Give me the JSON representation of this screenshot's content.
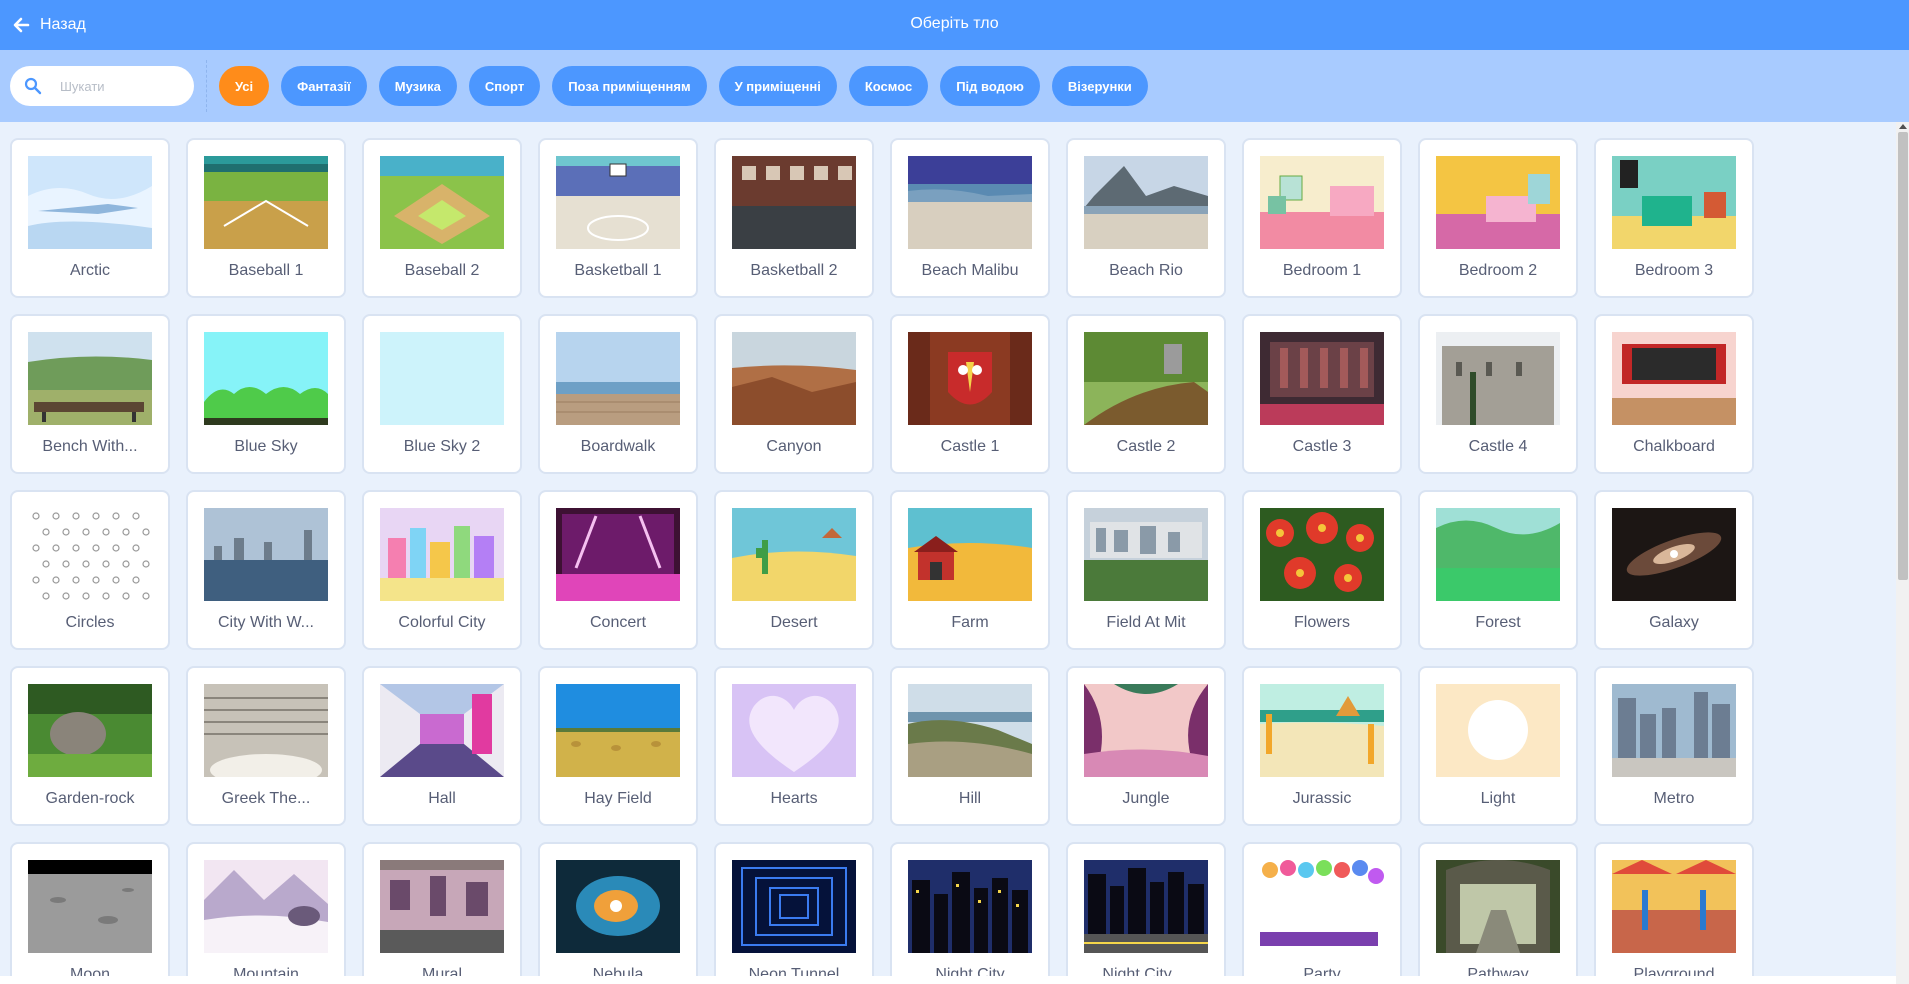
{
  "header": {
    "back_label": "Назад",
    "title": "Оберіть тло"
  },
  "search": {
    "placeholder": "Шукати",
    "value": ""
  },
  "tags": [
    {
      "label": "Усі",
      "active": true
    },
    {
      "label": "Фантазії",
      "active": false
    },
    {
      "label": "Музика",
      "active": false
    },
    {
      "label": "Спорт",
      "active": false
    },
    {
      "label": "Поза приміщенням",
      "active": false
    },
    {
      "label": "У приміщенні",
      "active": false
    },
    {
      "label": "Космос",
      "active": false
    },
    {
      "label": "Під водою",
      "active": false
    },
    {
      "label": "Візерунки",
      "active": false
    }
  ],
  "colors": {
    "header": "#4c97ff",
    "filterbar": "#a8cbff",
    "active_tag": "#ff8c1a",
    "tag": "#4c97ff",
    "background": "#e9f1fc"
  },
  "backdrops": [
    {
      "name": "Arctic",
      "thumb": "arctic"
    },
    {
      "name": "Baseball 1",
      "thumb": "baseball1"
    },
    {
      "name": "Baseball 2",
      "thumb": "baseball2"
    },
    {
      "name": "Basketball 1",
      "thumb": "basketball1"
    },
    {
      "name": "Basketball 2",
      "thumb": "basketball2"
    },
    {
      "name": "Beach Malibu",
      "thumb": "beach-malibu"
    },
    {
      "name": "Beach Rio",
      "thumb": "beach-rio"
    },
    {
      "name": "Bedroom 1",
      "thumb": "bedroom1"
    },
    {
      "name": "Bedroom 2",
      "thumb": "bedroom2"
    },
    {
      "name": "Bedroom 3",
      "thumb": "bedroom3"
    },
    {
      "name": "Bench With...",
      "thumb": "bench"
    },
    {
      "name": "Blue Sky",
      "thumb": "blue-sky"
    },
    {
      "name": "Blue Sky 2",
      "thumb": "blue-sky-2"
    },
    {
      "name": "Boardwalk",
      "thumb": "boardwalk"
    },
    {
      "name": "Canyon",
      "thumb": "canyon"
    },
    {
      "name": "Castle 1",
      "thumb": "castle1"
    },
    {
      "name": "Castle 2",
      "thumb": "castle2"
    },
    {
      "name": "Castle 3",
      "thumb": "castle3"
    },
    {
      "name": "Castle 4",
      "thumb": "castle4"
    },
    {
      "name": "Chalkboard",
      "thumb": "chalkboard"
    },
    {
      "name": "Circles",
      "thumb": "circles"
    },
    {
      "name": "City With W...",
      "thumb": "city-water"
    },
    {
      "name": "Colorful City",
      "thumb": "colorful-city"
    },
    {
      "name": "Concert",
      "thumb": "concert"
    },
    {
      "name": "Desert",
      "thumb": "desert"
    },
    {
      "name": "Farm",
      "thumb": "farm"
    },
    {
      "name": "Field At Mit",
      "thumb": "field-mit"
    },
    {
      "name": "Flowers",
      "thumb": "flowers"
    },
    {
      "name": "Forest",
      "thumb": "forest"
    },
    {
      "name": "Galaxy",
      "thumb": "galaxy"
    },
    {
      "name": "Garden-rock",
      "thumb": "garden-rock"
    },
    {
      "name": "Greek The...",
      "thumb": "greek-theater"
    },
    {
      "name": "Hall",
      "thumb": "hall"
    },
    {
      "name": "Hay Field",
      "thumb": "hay-field"
    },
    {
      "name": "Hearts",
      "thumb": "hearts"
    },
    {
      "name": "Hill",
      "thumb": "hill"
    },
    {
      "name": "Jungle",
      "thumb": "jungle"
    },
    {
      "name": "Jurassic",
      "thumb": "jurassic"
    },
    {
      "name": "Light",
      "thumb": "light"
    },
    {
      "name": "Metro",
      "thumb": "metro"
    },
    {
      "name": "Moon",
      "thumb": "moon"
    },
    {
      "name": "Mountain",
      "thumb": "mountain"
    },
    {
      "name": "Mural",
      "thumb": "mural"
    },
    {
      "name": "Nebula",
      "thumb": "nebula"
    },
    {
      "name": "Neon Tunnel",
      "thumb": "neon-tunnel"
    },
    {
      "name": "Night City",
      "thumb": "night-city"
    },
    {
      "name": "Night City ...",
      "thumb": "night-city-2"
    },
    {
      "name": "Party",
      "thumb": "party"
    },
    {
      "name": "Pathway",
      "thumb": "pathway"
    },
    {
      "name": "Playground",
      "thumb": "playground"
    }
  ]
}
